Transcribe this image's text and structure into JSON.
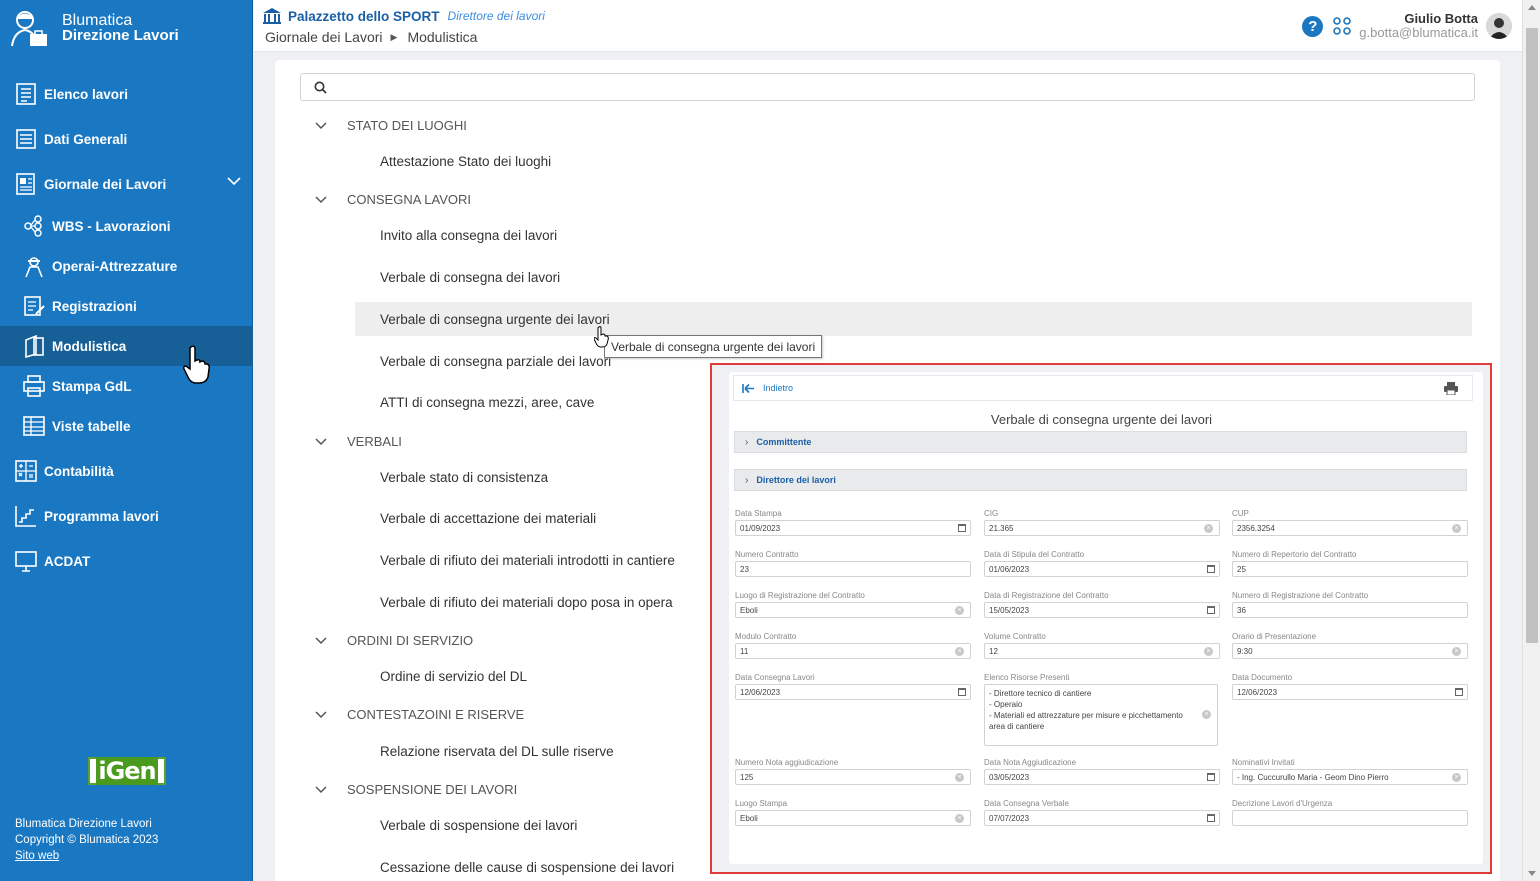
{
  "app": {
    "name_line1": "Blumatica",
    "name_line2": "Direzione Lavori"
  },
  "sidebar": {
    "items": [
      {
        "label": "Elenco lavori"
      },
      {
        "label": "Dati Generali"
      },
      {
        "label": "Giornale dei Lavori"
      },
      {
        "label": "WBS - Lavorazioni"
      },
      {
        "label": "Operai-Attrezzature"
      },
      {
        "label": "Registrazioni"
      },
      {
        "label": "Modulistica"
      },
      {
        "label": "Stampa GdL"
      },
      {
        "label": "Viste tabelle"
      },
      {
        "label": "Contabilità"
      },
      {
        "label": "Programma lavori"
      },
      {
        "label": "ACDAT"
      }
    ],
    "logo_igen": "iGen",
    "footer": {
      "line1": "Blumatica Direzione Lavori",
      "line2": "Copyright © Blumatica 2023",
      "link": "Sito web"
    }
  },
  "header": {
    "project": "Palazzetto dello SPORT",
    "role": "Direttore dei lavori",
    "breadcrumb": [
      "Giornale dei Lavori",
      "Modulistica"
    ],
    "user_name": "Giulio Botta",
    "user_email": "g.botta@blumatica.it",
    "help": "?"
  },
  "tree": {
    "sections": [
      {
        "label": "STATO DEI LUOGHI"
      },
      {
        "label": "CONSEGNA LAVORI"
      },
      {
        "label": "VERBALI"
      },
      {
        "label": "ORDINI DI SERVIZIO"
      },
      {
        "label": "CONTESTAZOINI E RISERVE"
      },
      {
        "label": "SOSPENSIONE DEI LAVORI"
      }
    ],
    "items": [
      {
        "label": "Attestazione Stato dei luoghi"
      },
      {
        "label": "Invito alla consegna dei lavori"
      },
      {
        "label": "Verbale di consegna dei lavori"
      },
      {
        "label": "Verbale di consegna urgente dei lavori"
      },
      {
        "label": "Verbale di consegna parziale dei lavori"
      },
      {
        "label": "ATTI di consegna mezzi, aree, cave"
      },
      {
        "label": "Verbale stato di consistenza"
      },
      {
        "label": "Verbale di accettazione dei materiali"
      },
      {
        "label": "Verbale di rifiuto dei materiali introdotti in cantiere"
      },
      {
        "label": "Verbale di rifiuto dei materiali dopo posa in opera"
      },
      {
        "label": "Ordine di servizio del DL"
      },
      {
        "label": "Relazione riservata del DL sulle riserve"
      },
      {
        "label": "Verbale di sospensione dei lavori"
      },
      {
        "label": "Cessazione delle cause di sospensione dei lavori"
      }
    ],
    "tooltip": "Verbale di consegna urgente dei lavori"
  },
  "form": {
    "back_label": "Indietro",
    "title": "Verbale di consegna urgente dei lavori",
    "accordions": [
      {
        "label": "Committente"
      },
      {
        "label": "Direttore dei lavori"
      }
    ],
    "fields": [
      {
        "label": "Data Stampa",
        "value": "01/09/2023"
      },
      {
        "label": "CIG",
        "value": "21.365"
      },
      {
        "label": "CUP",
        "value": "2356.3254"
      },
      {
        "label": "Numero Contratto",
        "value": "23"
      },
      {
        "label": "Data di Stipula del Contratto",
        "value": "01/06/2023"
      },
      {
        "label": "Numero di Repertorio del Contratto",
        "value": "25"
      },
      {
        "label": "Luogo di Registrazione del Contratto",
        "value": "Eboli"
      },
      {
        "label": "Data di Registrazione del Contratto",
        "value": "15/05/2023"
      },
      {
        "label": "Numero di Registrazione del Contratto",
        "value": "36"
      },
      {
        "label": "Modulo Contratto",
        "value": "11"
      },
      {
        "label": "Volume Contratto",
        "value": "12"
      },
      {
        "label": "Orario di Presentazione",
        "value": "9:30"
      },
      {
        "label": "Data Consegna Lavori",
        "value": "12/06/2023"
      },
      {
        "label": "Elenco Risorse Presenti",
        "value": "- Direttore tecnico di cantiere\n- Operaio\n- Materiali ed attrezzature per misure e picchettamento area di cantiere"
      },
      {
        "label": "Data Documento",
        "value": "12/06/2023"
      },
      {
        "label": "Numero Nota aggiudicazione",
        "value": "125"
      },
      {
        "label": "Data Nota Aggiudicazione",
        "value": "03/05/2023"
      },
      {
        "label": "Nominativi Invitati",
        "value": "- Ing. Cuccurullo Maria - Geom Dino Pierro"
      },
      {
        "label": "Luogo Stampa",
        "value": "Eboli"
      },
      {
        "label": "Data Consegna Verbale",
        "value": "07/07/2023"
      },
      {
        "label": "Decrizione Lavori d'Urgenza",
        "value": ""
      }
    ]
  }
}
